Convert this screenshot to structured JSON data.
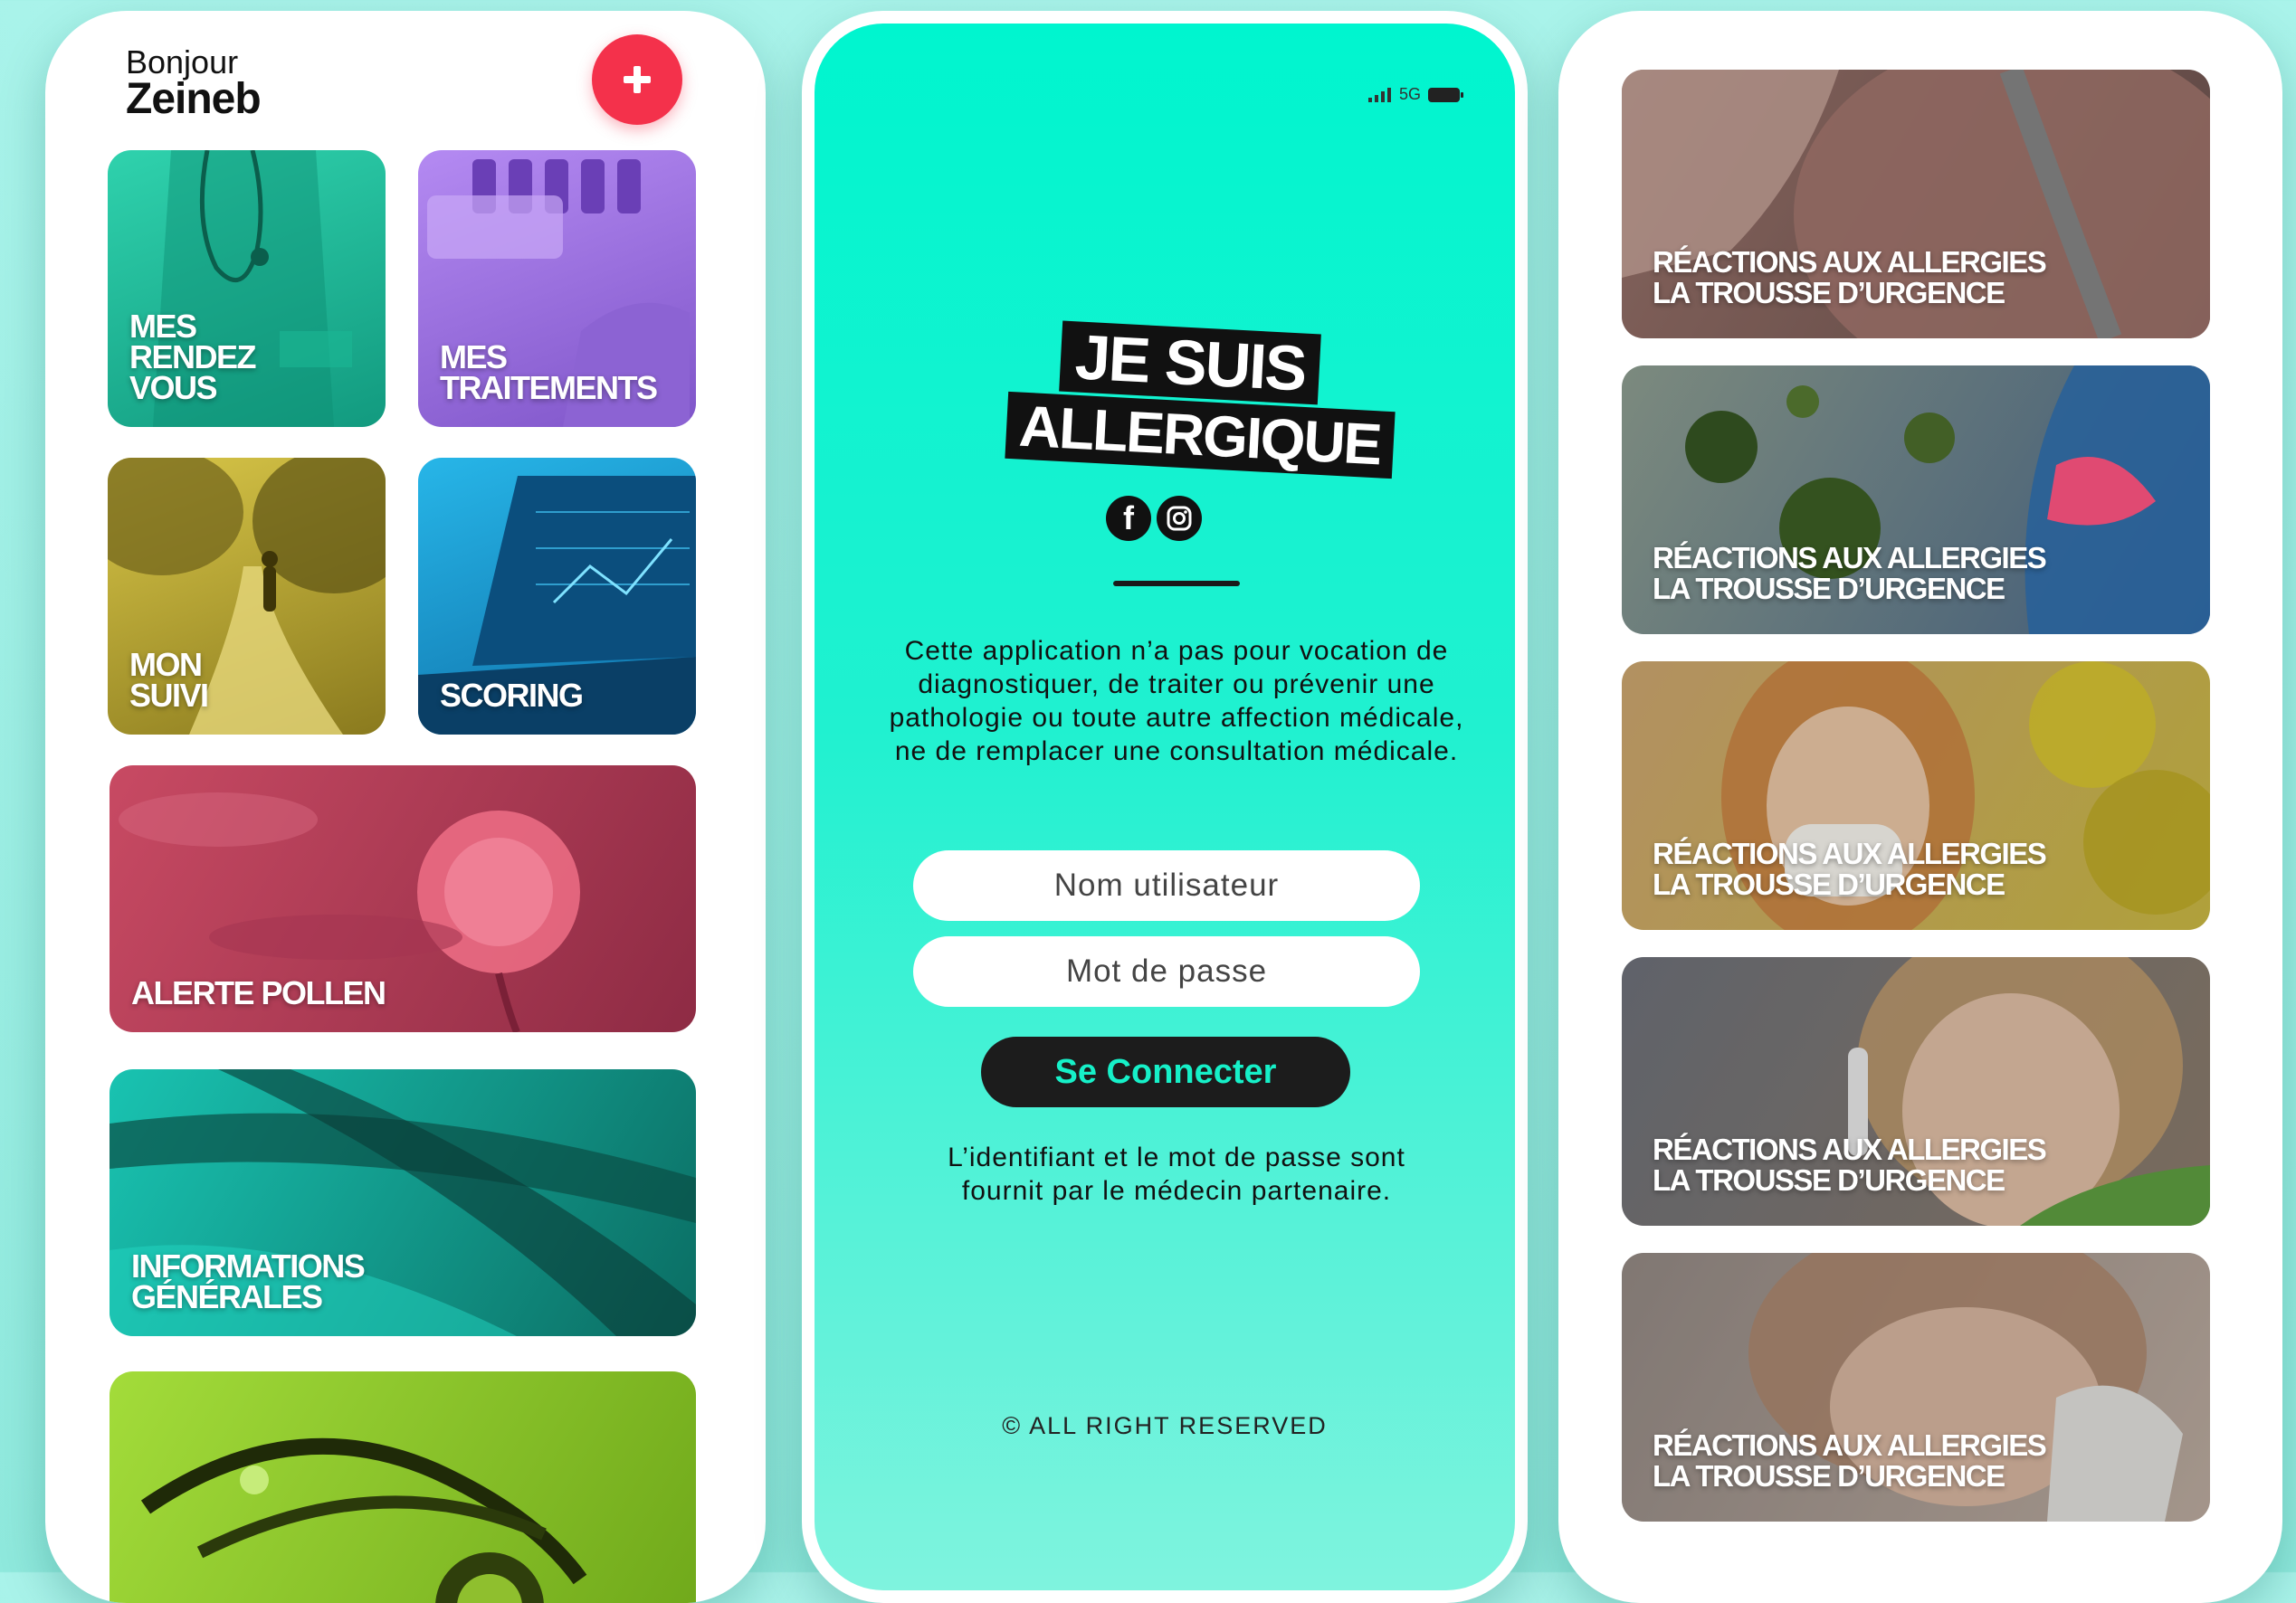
{
  "home": {
    "greeting": "Bonjour",
    "user_name": "Zeineb",
    "add_icon": "plus-icon",
    "tiles": [
      {
        "label": "MES\nRENDEZ\nVOUS",
        "color": "#1fb99a"
      },
      {
        "label": "MES\nTRAITEMENTS",
        "color": "#9b6fe0"
      },
      {
        "label": "MON\nSUIVI",
        "color": "#c9b12c"
      },
      {
        "label": "SCORING",
        "color": "#1aa0d8"
      },
      {
        "label": "ALERTE POLLEN",
        "color": "#c24760"
      },
      {
        "label": "INFORMATIONS\nGÉNÉRALES",
        "color": "#17b3a4"
      },
      {
        "label": "",
        "color": "#8fcf2c"
      }
    ]
  },
  "login": {
    "status": {
      "network": "5G"
    },
    "logo": {
      "line1": "JE SUIS",
      "line2": "ALLERGIQUE",
      "social_icons": [
        "facebook-icon",
        "instagram-icon"
      ]
    },
    "disclaimer": "Cette application n’a pas pour vocation de diagnostiquer, de traiter ou prévenir une pathologie ou toute autre affection médicale, ne de remplacer une consultation médicale.",
    "username_placeholder": "Nom utilisateur",
    "password_placeholder": "Mot de passe",
    "login_label": "Se Connecter",
    "credentials_note": "L’identifiant et le mot de passe sont fournit par le médecin partenaire.",
    "copyright": "© ALL RIGHT RESERVED",
    "accent": "#00f5cf"
  },
  "articles": {
    "cards": [
      {
        "line1": "RÉACTIONS AUX ALLERGIES",
        "line2": "LA TROUSSE D’URGENCE"
      },
      {
        "line1": "RÉACTIONS AUX ALLERGIES",
        "line2": "LA TROUSSE D’URGENCE"
      },
      {
        "line1": "RÉACTIONS AUX ALLERGIES",
        "line2": "LA TROUSSE D’URGENCE"
      },
      {
        "line1": "RÉACTIONS AUX ALLERGIES",
        "line2": "LA TROUSSE D’URGENCE"
      },
      {
        "line1": "RÉACTIONS AUX ALLERGIES",
        "line2": "LA TROUSSE D’URGENCE"
      }
    ]
  }
}
